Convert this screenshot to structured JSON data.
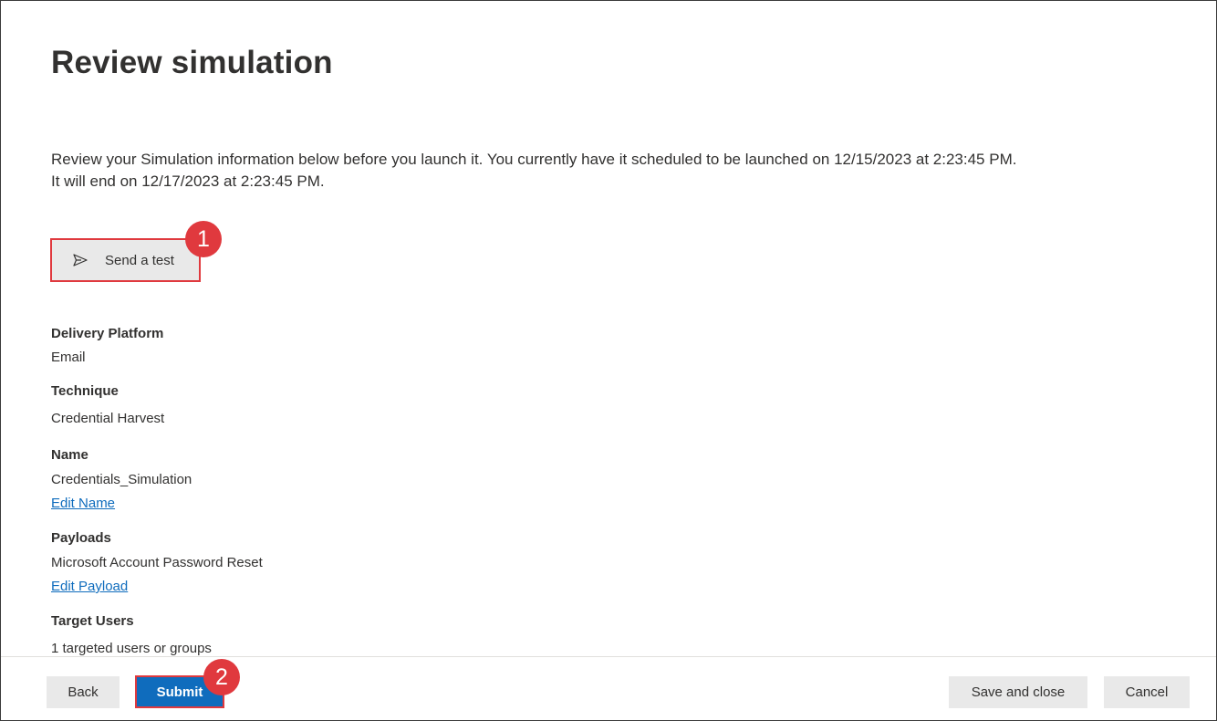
{
  "page": {
    "title": "Review simulation",
    "intro_line1": "Review your Simulation information below before you launch it. You currently have it scheduled to be launched on 12/15/2023 at 2:23:45 PM.",
    "intro_line2": "It will end on 12/17/2023 at 2:23:45 PM."
  },
  "send_test": {
    "label": "Send a test",
    "icon": "send-icon"
  },
  "callouts": {
    "one": "1",
    "two": "2",
    "color": "#e0393e"
  },
  "fields": {
    "delivery_platform": {
      "label": "Delivery Platform",
      "value": "Email"
    },
    "technique": {
      "label": "Technique",
      "value": "Credential Harvest"
    },
    "name": {
      "label": "Name",
      "value": "Credentials_Simulation",
      "link": "Edit Name"
    },
    "payloads": {
      "label": "Payloads",
      "value": "Microsoft Account Password Reset",
      "link": "Edit Payload"
    },
    "target_users": {
      "label": "Target Users",
      "value": "1 targeted users or groups"
    }
  },
  "footer": {
    "back": "Back",
    "submit": "Submit",
    "save_close": "Save and close",
    "cancel": "Cancel"
  },
  "colors": {
    "accent": "#0f6cbd",
    "highlight": "#e0393e",
    "button_bg": "#e9e9e9"
  }
}
